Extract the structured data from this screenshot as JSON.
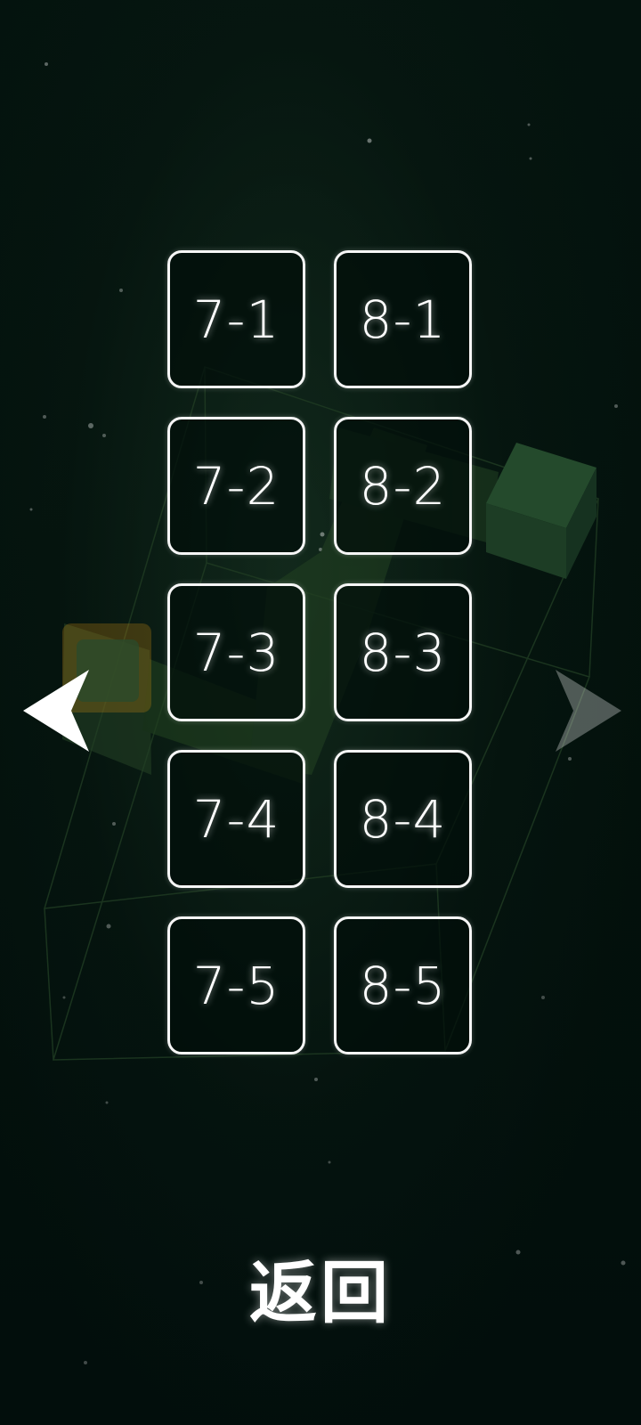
{
  "levels": [
    {
      "label": "7-1"
    },
    {
      "label": "8-1"
    },
    {
      "label": "7-2"
    },
    {
      "label": "8-2"
    },
    {
      "label": "7-3"
    },
    {
      "label": "8-3"
    },
    {
      "label": "7-4"
    },
    {
      "label": "8-4"
    },
    {
      "label": "7-5"
    },
    {
      "label": "8-5"
    }
  ],
  "navigation": {
    "prev_icon": "arrow-left-icon",
    "next_icon": "arrow-right-icon",
    "next_state": "disabled"
  },
  "footer": {
    "back_label": "返回"
  },
  "colors": {
    "background": "#03110c",
    "button_border": "#f6f6f6",
    "text": "#ffffff",
    "accent_green": "#2e5a32",
    "accent_orange": "#c98a12"
  }
}
